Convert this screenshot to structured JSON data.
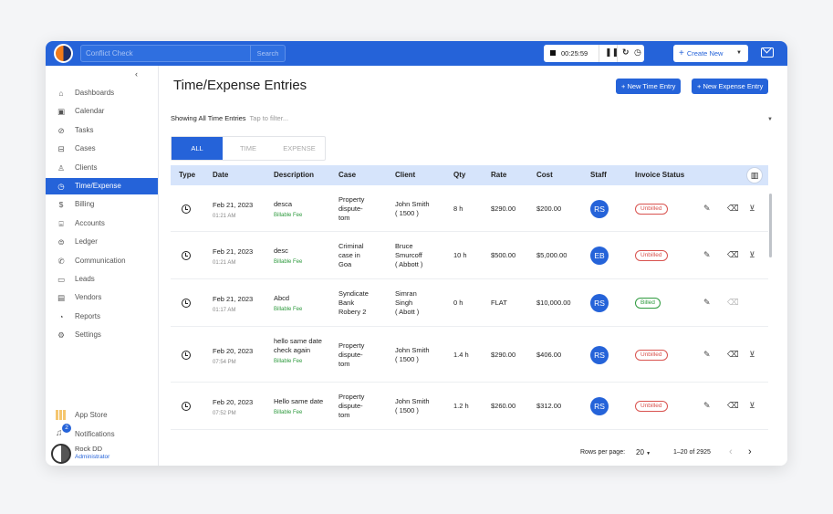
{
  "topbar": {
    "search_placeholder": "Conflict Check",
    "search_button": "Search",
    "timer": "00:25:59",
    "create_new": "Create New"
  },
  "sidebar": {
    "items": [
      {
        "label": "Dashboards",
        "icon": "home-icon"
      },
      {
        "label": "Calendar",
        "icon": "calendar-icon"
      },
      {
        "label": "Tasks",
        "icon": "check-circle-icon"
      },
      {
        "label": "Cases",
        "icon": "briefcase-icon"
      },
      {
        "label": "Clients",
        "icon": "user-icon"
      },
      {
        "label": "Time/Expense",
        "icon": "clock-icon",
        "active": true
      },
      {
        "label": "Billing",
        "icon": "dollar-icon"
      },
      {
        "label": "Accounts",
        "icon": "bank-icon"
      },
      {
        "label": "Ledger",
        "icon": "ledger-icon"
      },
      {
        "label": "Communication",
        "icon": "phone-icon"
      },
      {
        "label": "Leads",
        "icon": "leads-icon"
      },
      {
        "label": "Vendors",
        "icon": "vendor-icon"
      },
      {
        "label": "Reports",
        "icon": "pie-chart-icon"
      },
      {
        "label": "Settings",
        "icon": "gear-icon"
      }
    ],
    "app_store": "App Store",
    "notifications": "Notifications",
    "notification_count": "2",
    "user_name": "Rock DD",
    "user_role": "Administrator"
  },
  "main": {
    "title": "Time/Expense Entries",
    "new_time_entry": "+ New Time Entry",
    "new_expense_entry": "+ New Expense Entry",
    "filter_label": "Showing All Time Entries",
    "filter_placeholder": "Tap to filter...",
    "tabs": [
      "ALL",
      "TIME",
      "EXPENSE"
    ],
    "columns": [
      "Type",
      "Date",
      "Description",
      "Case",
      "Client",
      "Qty",
      "Rate",
      "Cost",
      "Staff",
      "Invoice Status"
    ],
    "rows": [
      {
        "date": "Feb 21, 2023",
        "time": "01:21 AM",
        "desc": "desca",
        "fee": "Billable Fee",
        "case": [
          "Property",
          "dispute-",
          "tom"
        ],
        "client": [
          "John Smith",
          "( 1500 )"
        ],
        "qty": "8 h",
        "rate": "$290.00",
        "cost": "$200.00",
        "staff": "RS",
        "status": "Unbilled"
      },
      {
        "date": "Feb 21, 2023",
        "time": "01:21 AM",
        "desc": "desc",
        "fee": "Billable Fee",
        "case": [
          "Criminal",
          "case in",
          "Goa"
        ],
        "client": [
          "Bruce",
          "Smurcoff",
          "( Abbott )"
        ],
        "qty": "10 h",
        "rate": "$500.00",
        "cost": "$5,000.00",
        "staff": "EB",
        "status": "Unbilled"
      },
      {
        "date": "Feb 21, 2023",
        "time": "01:17 AM",
        "desc": "Abcd",
        "fee": "Billable Fee",
        "case": [
          "Syndicate",
          "Bank",
          "Robery 2"
        ],
        "client": [
          "Simran",
          "Singh",
          "( Abott )"
        ],
        "qty": "0 h",
        "rate": "FLAT",
        "cost": "$10,000.00",
        "staff": "RS",
        "status": "Billed"
      },
      {
        "date": "Feb 20, 2023",
        "time": "07:54 PM",
        "desc": "hello same date check again",
        "fee": "Billable Fee",
        "case": [
          "Property",
          "dispute-",
          "tom"
        ],
        "client": [
          "John Smith",
          "( 1500 )"
        ],
        "qty": "1.4 h",
        "rate": "$290.00",
        "cost": "$406.00",
        "staff": "RS",
        "status": "Unbilled"
      },
      {
        "date": "Feb 20, 2023",
        "time": "07:52 PM",
        "desc": "Hello same date",
        "fee": "Billable Fee",
        "case": [
          "Property",
          "dispute-",
          "tom"
        ],
        "client": [
          "John Smith",
          "( 1500 )"
        ],
        "qty": "1.2 h",
        "rate": "$260.00",
        "cost": "$312.00",
        "staff": "RS",
        "status": "Unbilled"
      }
    ],
    "footer": {
      "rows_per_page_label": "Rows per page:",
      "rows_per_page": "20",
      "range": "1–20 of 2925"
    }
  },
  "colors": {
    "accent": "#2563d9",
    "unbilled": "#d9534f",
    "billed": "#2e9a3e",
    "header_bg": "#d6e4fb"
  }
}
